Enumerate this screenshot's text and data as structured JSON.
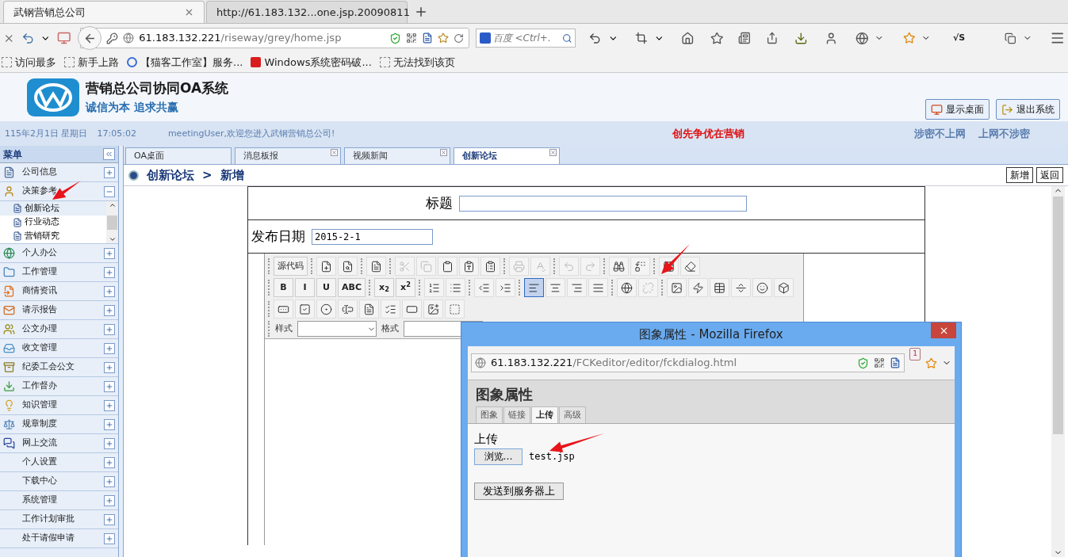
{
  "browser": {
    "tabs": [
      {
        "title": "武钢营销总公司",
        "selected": true
      },
      {
        "title": "http://61.183.132...one.jsp.20090811",
        "selected": false
      }
    ],
    "url": {
      "host": "61.183.132.221",
      "path": "/riseway/grey/home.jsp"
    },
    "search": {
      "placeholder": "百度 <Ctrl+."
    },
    "extension_label": "√S",
    "bookmarks": [
      "访问最多",
      "新手上路",
      "【猫客工作室】服务...",
      "Windows系统密码破...",
      "无法找到该页"
    ]
  },
  "header": {
    "title": "营销总公司协同OA系统",
    "slogan": "诚信为本 追求共赢",
    "buttons": [
      "显示桌面",
      "退出系统"
    ]
  },
  "status_line": {
    "date": "115年2月1日 星期日",
    "time": "17:05:02",
    "welcome": "meetingUser,欢迎您进入武钢营销总公司!",
    "motto": "创先争优在营销",
    "notices": [
      "涉密不上网",
      "上网不涉密"
    ]
  },
  "sidebar": {
    "title": "菜单",
    "items": [
      {
        "label": "公司信息",
        "kind": "with-icon",
        "expanded": false
      },
      {
        "label": "决策参考",
        "kind": "with-icon",
        "expanded": true,
        "children": [
          {
            "label": "创新论坛",
            "selected": true
          },
          {
            "label": "行业动态",
            "selected": false
          },
          {
            "label": "营销研究",
            "selected": false
          }
        ]
      },
      {
        "label": "个人办公",
        "kind": "with-icon",
        "expanded": false
      },
      {
        "label": "工作管理",
        "kind": "with-icon",
        "expanded": false
      },
      {
        "label": "商情资讯",
        "kind": "with-icon",
        "expanded": false
      },
      {
        "label": "请示报告",
        "kind": "with-icon",
        "expanded": false
      },
      {
        "label": "公文办理",
        "kind": "with-icon",
        "expanded": false
      },
      {
        "label": "收文管理",
        "kind": "with-icon",
        "expanded": false
      },
      {
        "label": "纪委工会公文",
        "kind": "with-icon",
        "expanded": false
      },
      {
        "label": "工作督办",
        "kind": "with-icon",
        "expanded": false
      },
      {
        "label": "知识管理",
        "kind": "with-icon",
        "expanded": false
      },
      {
        "label": "规章制度",
        "kind": "with-icon",
        "expanded": false
      },
      {
        "label": "网上交流",
        "kind": "with-icon",
        "expanded": false
      },
      {
        "label": "个人设置",
        "kind": "plain",
        "expanded": false
      },
      {
        "label": "下载中心",
        "kind": "plain",
        "expanded": false
      },
      {
        "label": "系统管理",
        "kind": "plain",
        "expanded": false
      },
      {
        "label": "工作计划审批",
        "kind": "plain",
        "expanded": false
      },
      {
        "label": "处干请假申请",
        "kind": "plain",
        "expanded": false
      }
    ]
  },
  "content_tabs": [
    {
      "label": "OA桌面",
      "selected": false,
      "closable": false
    },
    {
      "label": "消息板报",
      "selected": false,
      "closable": true
    },
    {
      "label": "视频新闻",
      "selected": false,
      "closable": true
    },
    {
      "label": "创新论坛",
      "selected": true,
      "closable": true
    }
  ],
  "breadcrumb": [
    "创新论坛",
    ">",
    "新增"
  ],
  "page_buttons": [
    "新增",
    "返回"
  ],
  "form": {
    "title_label": "标题",
    "date_label": "发布日期",
    "date_value": "2015-2-1"
  },
  "editor": {
    "toolbar_rows": [
      [
        {
          "kind": "label",
          "label": "源代码"
        },
        {
          "kind": "separator"
        },
        {
          "kind": "icon",
          "disabled": false,
          "selected": false
        },
        {
          "kind": "icon",
          "disabled": false,
          "selected": false
        },
        {
          "kind": "separator"
        },
        {
          "kind": "icon",
          "disabled": false,
          "selected": false
        },
        {
          "kind": "separator"
        },
        {
          "kind": "icon",
          "disabled": true,
          "selected": false
        },
        {
          "kind": "icon",
          "disabled": true,
          "selected": false
        },
        {
          "kind": "icon",
          "disabled": false,
          "selected": false
        },
        {
          "kind": "icon",
          "disabled": false,
          "selected": false
        },
        {
          "kind": "icon",
          "disabled": false,
          "selected": false
        },
        {
          "kind": "separator"
        },
        {
          "kind": "icon",
          "disabled": true,
          "selected": false
        },
        {
          "kind": "icon",
          "disabled": true,
          "selected": false
        },
        {
          "kind": "separator"
        },
        {
          "kind": "icon",
          "disabled": true,
          "selected": false
        },
        {
          "kind": "icon",
          "disabled": true,
          "selected": false
        },
        {
          "kind": "separator"
        },
        {
          "kind": "icon",
          "disabled": false,
          "selected": false
        },
        {
          "kind": "icon",
          "disabled": false,
          "selected": false
        },
        {
          "kind": "separator"
        },
        {
          "kind": "icon",
          "disabled": false,
          "selected": false
        },
        {
          "kind": "icon",
          "disabled": false,
          "selected": false
        }
      ],
      [
        {
          "kind": "label",
          "label": "B"
        },
        {
          "kind": "label",
          "label": "I"
        },
        {
          "kind": "label",
          "label": "U"
        },
        {
          "kind": "label",
          "label": "ABC"
        },
        {
          "kind": "separator"
        },
        {
          "kind": "label",
          "label": "x$_{2}$"
        },
        {
          "kind": "label",
          "label": "x$^{2}$"
        },
        {
          "kind": "separator"
        },
        {
          "kind": "icon",
          "disabled": false,
          "selected": false
        },
        {
          "kind": "icon",
          "disabled": false,
          "selected": false
        },
        {
          "kind": "separator"
        },
        {
          "kind": "icon",
          "disabled": false,
          "selected": false
        },
        {
          "kind": "icon",
          "disabled": false,
          "selected": false
        },
        {
          "kind": "separator"
        },
        {
          "kind": "icon",
          "disabled": false,
          "selected": true
        },
        {
          "kind": "icon",
          "disabled": false,
          "selected": false
        },
        {
          "kind": "icon",
          "disabled": false,
          "selected": false
        },
        {
          "kind": "icon",
          "disabled": false,
          "selected": false
        },
        {
          "kind": "separator"
        },
        {
          "kind": "icon",
          "disabled": false,
          "selected": false
        },
        {
          "kind": "icon",
          "disabled": true,
          "selected": false
        },
        {
          "kind": "separator"
        },
        {
          "kind": "icon",
          "disabled": false,
          "selected": false
        },
        {
          "kind": "icon",
          "disabled": false,
          "selected": false
        },
        {
          "kind": "icon",
          "disabled": false,
          "selected": false
        },
        {
          "kind": "icon",
          "disabled": false,
          "selected": false
        },
        {
          "kind": "icon",
          "disabled": false,
          "selected": false
        },
        {
          "kind": "icon",
          "disabled": false,
          "selected": false
        }
      ],
      [
        {
          "kind": "icon",
          "disabled": false,
          "selected": false
        },
        {
          "kind": "icon",
          "disabled": false,
          "selected": false
        },
        {
          "kind": "icon",
          "disabled": false,
          "selected": false
        },
        {
          "kind": "icon",
          "disabled": false,
          "selected": false
        },
        {
          "kind": "icon",
          "disabled": false,
          "selected": false
        },
        {
          "kind": "icon",
          "disabled": false,
          "selected": false
        },
        {
          "kind": "icon",
          "disabled": false,
          "selected": false
        },
        {
          "kind": "icon",
          "disabled": false,
          "selected": false
        },
        {
          "kind": "icon",
          "disabled": false,
          "selected": false
        }
      ]
    ],
    "style_label": "样式",
    "format_label": "格式"
  },
  "dialog": {
    "window_title": "图象属性 - Mozilla Firefox",
    "url": {
      "host": "61.183.132.221",
      "path": "/FCKeditor/editor/fckdialog.html"
    },
    "badge": "1",
    "heading": "图象属性",
    "tabs": [
      {
        "label": "图象",
        "selected": false
      },
      {
        "label": "链接",
        "selected": false
      },
      {
        "label": "上传",
        "selected": true
      },
      {
        "label": "高级",
        "selected": false
      }
    ],
    "section_label": "上传",
    "browse_button": "浏览…",
    "file_name": "test.jsp",
    "send_button": "发送到服务器上"
  }
}
